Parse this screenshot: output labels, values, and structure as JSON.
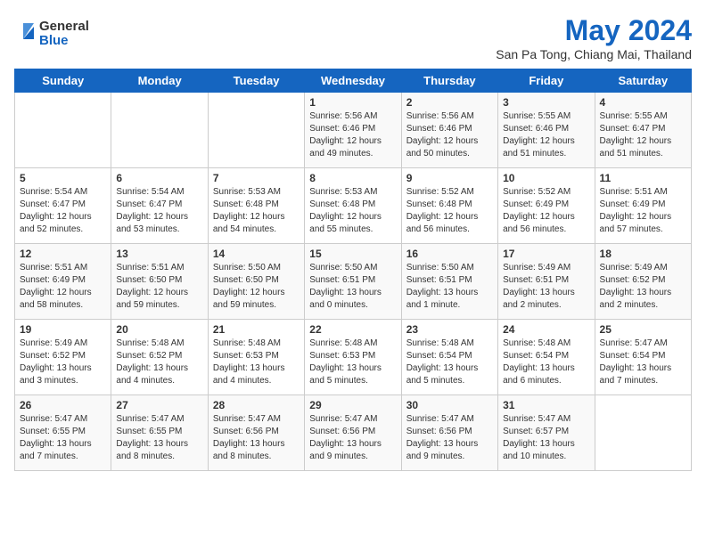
{
  "logo": {
    "general": "General",
    "blue": "Blue"
  },
  "title": "May 2024",
  "subtitle": "San Pa Tong, Chiang Mai, Thailand",
  "days_of_week": [
    "Sunday",
    "Monday",
    "Tuesday",
    "Wednesday",
    "Thursday",
    "Friday",
    "Saturday"
  ],
  "weeks": [
    [
      {
        "day": "",
        "info": ""
      },
      {
        "day": "",
        "info": ""
      },
      {
        "day": "",
        "info": ""
      },
      {
        "day": "1",
        "info": "Sunrise: 5:56 AM\nSunset: 6:46 PM\nDaylight: 12 hours\nand 49 minutes."
      },
      {
        "day": "2",
        "info": "Sunrise: 5:56 AM\nSunset: 6:46 PM\nDaylight: 12 hours\nand 50 minutes."
      },
      {
        "day": "3",
        "info": "Sunrise: 5:55 AM\nSunset: 6:46 PM\nDaylight: 12 hours\nand 51 minutes."
      },
      {
        "day": "4",
        "info": "Sunrise: 5:55 AM\nSunset: 6:47 PM\nDaylight: 12 hours\nand 51 minutes."
      }
    ],
    [
      {
        "day": "5",
        "info": "Sunrise: 5:54 AM\nSunset: 6:47 PM\nDaylight: 12 hours\nand 52 minutes."
      },
      {
        "day": "6",
        "info": "Sunrise: 5:54 AM\nSunset: 6:47 PM\nDaylight: 12 hours\nand 53 minutes."
      },
      {
        "day": "7",
        "info": "Sunrise: 5:53 AM\nSunset: 6:48 PM\nDaylight: 12 hours\nand 54 minutes."
      },
      {
        "day": "8",
        "info": "Sunrise: 5:53 AM\nSunset: 6:48 PM\nDaylight: 12 hours\nand 55 minutes."
      },
      {
        "day": "9",
        "info": "Sunrise: 5:52 AM\nSunset: 6:48 PM\nDaylight: 12 hours\nand 56 minutes."
      },
      {
        "day": "10",
        "info": "Sunrise: 5:52 AM\nSunset: 6:49 PM\nDaylight: 12 hours\nand 56 minutes."
      },
      {
        "day": "11",
        "info": "Sunrise: 5:51 AM\nSunset: 6:49 PM\nDaylight: 12 hours\nand 57 minutes."
      }
    ],
    [
      {
        "day": "12",
        "info": "Sunrise: 5:51 AM\nSunset: 6:49 PM\nDaylight: 12 hours\nand 58 minutes."
      },
      {
        "day": "13",
        "info": "Sunrise: 5:51 AM\nSunset: 6:50 PM\nDaylight: 12 hours\nand 59 minutes."
      },
      {
        "day": "14",
        "info": "Sunrise: 5:50 AM\nSunset: 6:50 PM\nDaylight: 12 hours\nand 59 minutes."
      },
      {
        "day": "15",
        "info": "Sunrise: 5:50 AM\nSunset: 6:51 PM\nDaylight: 13 hours\nand 0 minutes."
      },
      {
        "day": "16",
        "info": "Sunrise: 5:50 AM\nSunset: 6:51 PM\nDaylight: 13 hours\nand 1 minute."
      },
      {
        "day": "17",
        "info": "Sunrise: 5:49 AM\nSunset: 6:51 PM\nDaylight: 13 hours\nand 2 minutes."
      },
      {
        "day": "18",
        "info": "Sunrise: 5:49 AM\nSunset: 6:52 PM\nDaylight: 13 hours\nand 2 minutes."
      }
    ],
    [
      {
        "day": "19",
        "info": "Sunrise: 5:49 AM\nSunset: 6:52 PM\nDaylight: 13 hours\nand 3 minutes."
      },
      {
        "day": "20",
        "info": "Sunrise: 5:48 AM\nSunset: 6:52 PM\nDaylight: 13 hours\nand 4 minutes."
      },
      {
        "day": "21",
        "info": "Sunrise: 5:48 AM\nSunset: 6:53 PM\nDaylight: 13 hours\nand 4 minutes."
      },
      {
        "day": "22",
        "info": "Sunrise: 5:48 AM\nSunset: 6:53 PM\nDaylight: 13 hours\nand 5 minutes."
      },
      {
        "day": "23",
        "info": "Sunrise: 5:48 AM\nSunset: 6:54 PM\nDaylight: 13 hours\nand 5 minutes."
      },
      {
        "day": "24",
        "info": "Sunrise: 5:48 AM\nSunset: 6:54 PM\nDaylight: 13 hours\nand 6 minutes."
      },
      {
        "day": "25",
        "info": "Sunrise: 5:47 AM\nSunset: 6:54 PM\nDaylight: 13 hours\nand 7 minutes."
      }
    ],
    [
      {
        "day": "26",
        "info": "Sunrise: 5:47 AM\nSunset: 6:55 PM\nDaylight: 13 hours\nand 7 minutes."
      },
      {
        "day": "27",
        "info": "Sunrise: 5:47 AM\nSunset: 6:55 PM\nDaylight: 13 hours\nand 8 minutes."
      },
      {
        "day": "28",
        "info": "Sunrise: 5:47 AM\nSunset: 6:56 PM\nDaylight: 13 hours\nand 8 minutes."
      },
      {
        "day": "29",
        "info": "Sunrise: 5:47 AM\nSunset: 6:56 PM\nDaylight: 13 hours\nand 9 minutes."
      },
      {
        "day": "30",
        "info": "Sunrise: 5:47 AM\nSunset: 6:56 PM\nDaylight: 13 hours\nand 9 minutes."
      },
      {
        "day": "31",
        "info": "Sunrise: 5:47 AM\nSunset: 6:57 PM\nDaylight: 13 hours\nand 10 minutes."
      },
      {
        "day": "",
        "info": ""
      }
    ]
  ]
}
